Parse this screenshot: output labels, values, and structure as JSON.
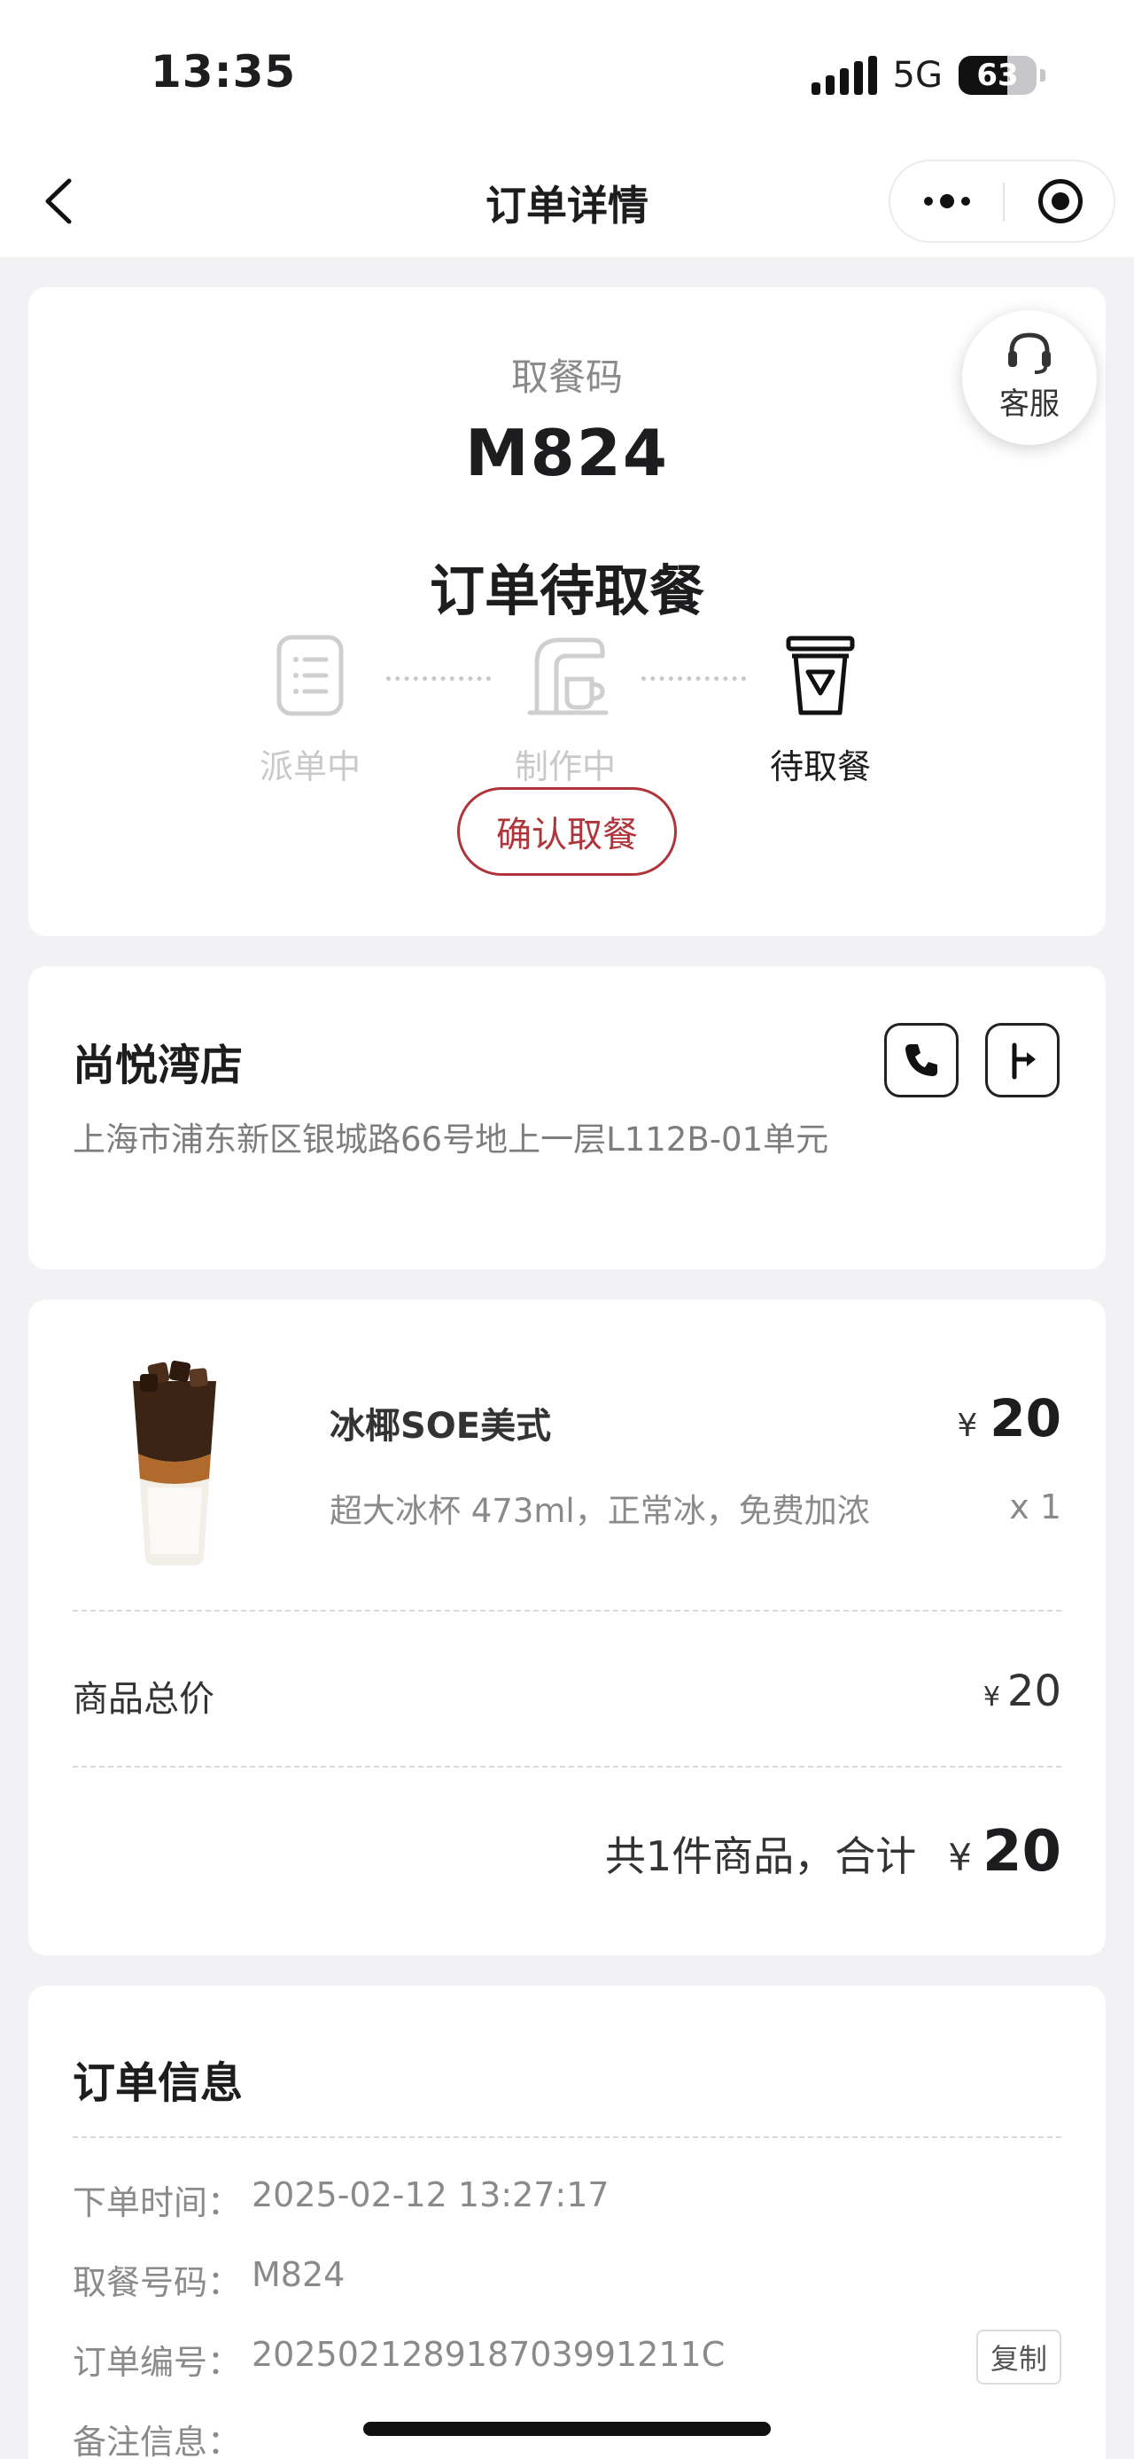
{
  "status_bar": {
    "time": "13:35",
    "network": "5G",
    "battery": "63",
    "battery_level": 0.63
  },
  "nav": {
    "title": "订单详情"
  },
  "pickup": {
    "label": "取餐码",
    "code": "M824",
    "status": "订单待取餐",
    "steps": [
      {
        "label": "派单中",
        "icon": "order-list-icon",
        "active": false
      },
      {
        "label": "制作中",
        "icon": "coffee-machine-icon",
        "active": false
      },
      {
        "label": "待取餐",
        "icon": "cup-icon",
        "active": true
      }
    ],
    "confirm_button": "确认取餐",
    "service_label": "客服"
  },
  "store": {
    "name": "尚悦湾店",
    "address": "上海市浦东新区银城路66号地上一层L112B-01单元"
  },
  "product": {
    "name": "冰椰SOE美式",
    "spec": "超大冰杯 473ml，正常冰，免费加浓",
    "currency": "¥",
    "price": "20",
    "quantity": "x 1",
    "subtotal_label": "商品总价",
    "subtotal": "20",
    "total_text": "共1件商品，合计",
    "total": "20"
  },
  "order_info": {
    "title": "订单信息",
    "rows": [
      {
        "key": "下单时间：",
        "value": "2025-02-12 13:27:17"
      },
      {
        "key": "取餐号码：",
        "value": "M824"
      },
      {
        "key": "订单编号：",
        "value": "20250212891870399121​1C"
      },
      {
        "key": "备注信息：",
        "value": ""
      }
    ],
    "copy_button": "复制"
  },
  "colors": {
    "accent": "#b0353a",
    "background": "#f2f2f4"
  }
}
